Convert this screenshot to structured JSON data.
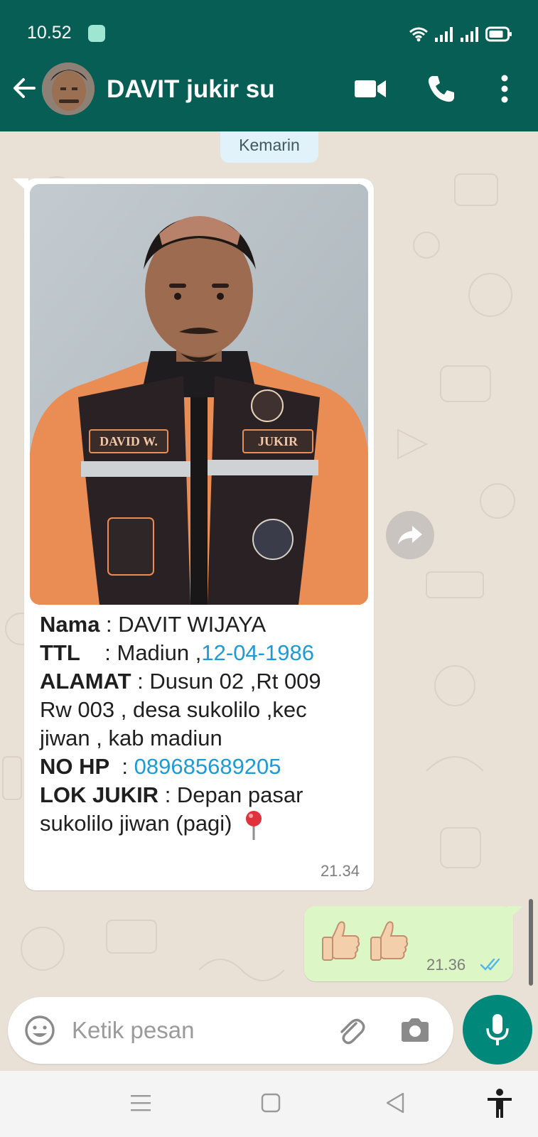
{
  "status_bar": {
    "time": "10.52"
  },
  "header": {
    "contact_name": "DAVIT jukir su",
    "icons": [
      "back-arrow-icon",
      "video-call-icon",
      "phone-icon",
      "more-vert-icon"
    ]
  },
  "chat": {
    "date_label": "Kemarin",
    "received": {
      "caption": {
        "nama_key": "Nama",
        "nama_value": " : DAVIT WIJAYA",
        "ttl_key": "TTL",
        "ttl_value": "    : Madiun ,",
        "ttl_date": "12-04-1986",
        "alamat_key": "ALAMAT",
        "alamat_value": " : Dusun 02 ,Rt 009 Rw 003 , desa sukolilo ,kec jiwan , kab madiun",
        "nohp_key": "NO HP",
        "nohp_sep": "  : ",
        "nohp_value": "089685689205",
        "lok_key": "LOK JUKIR",
        "lok_value": " : Depan pasar sukolilo jiwan (pagi)"
      },
      "photo_badges": {
        "name_tag": "DAVID W.",
        "role_tag": "JUKIR"
      },
      "time": "21.34"
    },
    "sent": {
      "content": "thumbs-up x2",
      "time": "21.36",
      "status": "read"
    }
  },
  "input": {
    "placeholder": "Ketik pesan"
  },
  "colors": {
    "header": "#075e54",
    "incoming_bubble": "#ffffff",
    "outgoing_bubble": "#dcf7c5",
    "link": "#1c9bd6",
    "mic_button": "#00897b",
    "read_ticks": "#4fb6ec"
  }
}
